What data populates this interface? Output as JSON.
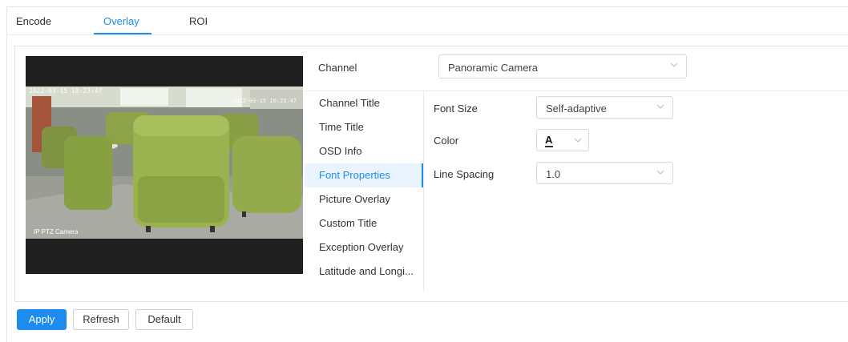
{
  "tabs": [
    {
      "label": "Encode",
      "active": false
    },
    {
      "label": "Overlay",
      "active": true
    },
    {
      "label": "ROI",
      "active": false
    }
  ],
  "preview": {
    "timestamp_text": "2022-03-15 10:23:47",
    "channel_name_overlay": "IP PTZ Camera"
  },
  "channel": {
    "label": "Channel",
    "value": "Panoramic Camera"
  },
  "menu": [
    {
      "label": "Channel Title",
      "active": false
    },
    {
      "label": "Time Title",
      "active": false
    },
    {
      "label": "OSD Info",
      "active": false
    },
    {
      "label": "Font Properties",
      "active": true
    },
    {
      "label": "Picture Overlay",
      "active": false
    },
    {
      "label": "Custom Title",
      "active": false
    },
    {
      "label": "Exception Overlay",
      "active": false
    },
    {
      "label": "Latitude and Longi...",
      "active": false
    }
  ],
  "font_properties": {
    "font_size_label": "Font Size",
    "font_size_value": "Self-adaptive",
    "color_label": "Color",
    "color_glyph": "A",
    "line_spacing_label": "Line Spacing",
    "line_spacing_value": "1.0"
  },
  "buttons": {
    "apply": "Apply",
    "refresh": "Refresh",
    "default": "Default"
  },
  "colors": {
    "accent": "#1d8cf0",
    "active_menu_bg": "#eaf4fe",
    "chair_green": "#8fa548"
  },
  "icons": [
    "chevron-down-icon"
  ]
}
